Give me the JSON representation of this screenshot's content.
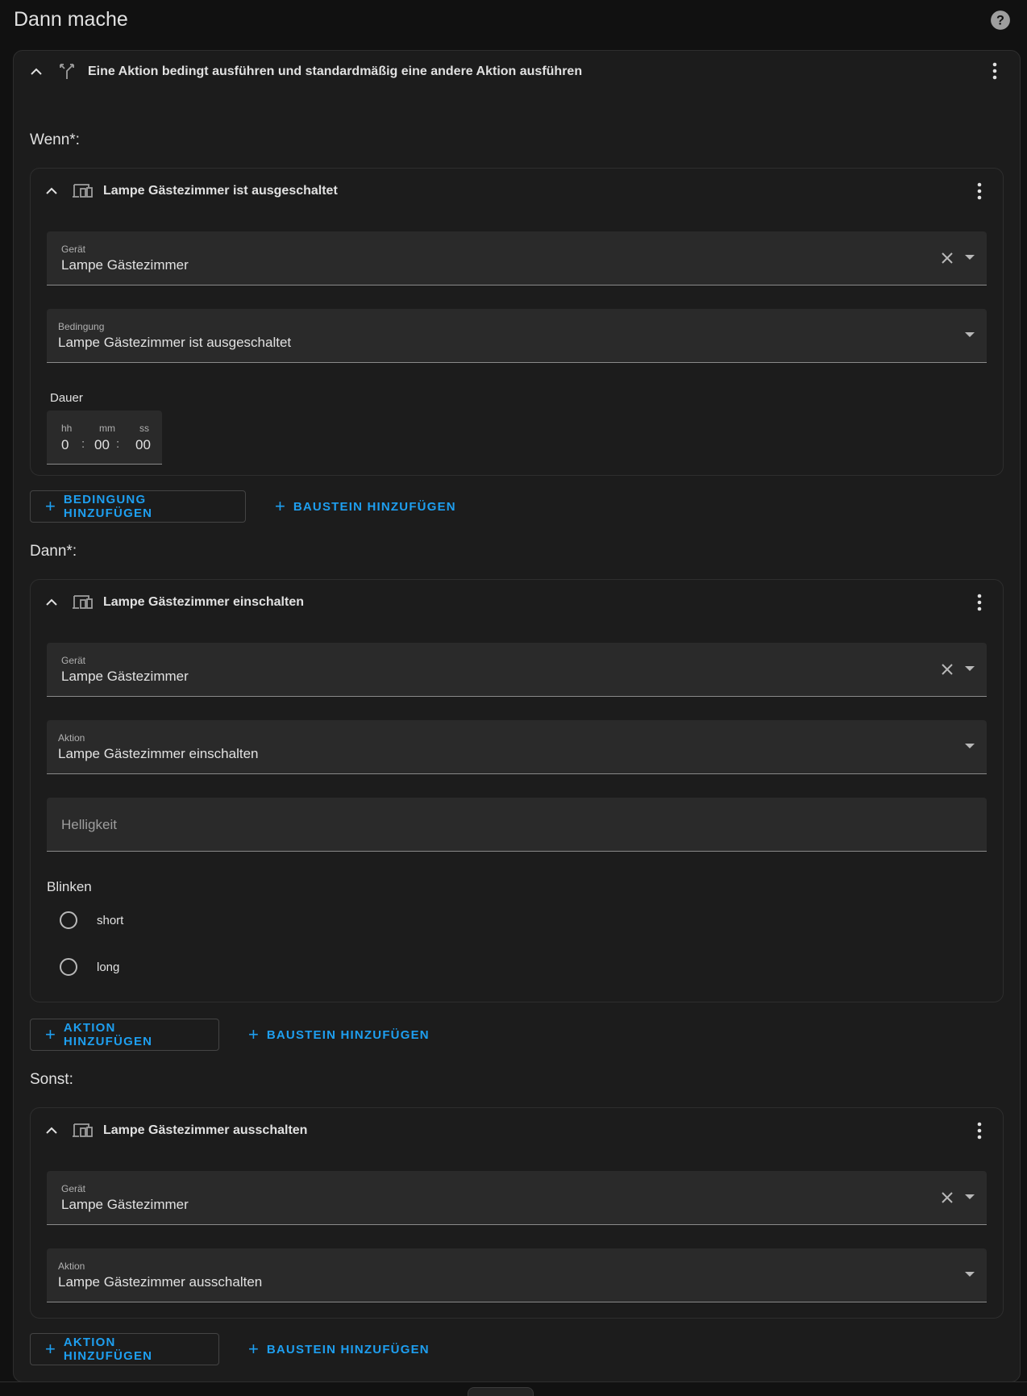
{
  "page": {
    "title": "Dann mache"
  },
  "outer": {
    "header": "Eine Aktion bedingt ausführen und standardmäßig eine andere Aktion ausführen"
  },
  "if": {
    "label": "Wenn*:",
    "card_title": "Lampe Gästezimmer ist ausgeschaltet",
    "device_label": "Gerät",
    "device_value": "Lampe Gästezimmer",
    "condition_label": "Bedingung",
    "condition_value": "Lampe Gästezimmer ist ausgeschaltet",
    "duration_label": "Dauer",
    "duration": {
      "hh_label": "hh",
      "mm_label": "mm",
      "ss_label": "ss",
      "hh": "0",
      "mm": "00",
      "ss": "00",
      "sep": ":"
    },
    "add_condition": "BEDINGUNG HINZUFÜGEN",
    "add_block": "BAUSTEIN HINZUFÜGEN"
  },
  "then": {
    "label": "Dann*:",
    "card_title": "Lampe Gästezimmer einschalten",
    "device_label": "Gerät",
    "device_value": "Lampe Gästezimmer",
    "action_label": "Aktion",
    "action_value": "Lampe Gästezimmer einschalten",
    "brightness_placeholder": "Helligkeit",
    "flash_label": "Blinken",
    "flash_options": [
      "short",
      "long"
    ],
    "add_action": "AKTION HINZUFÜGEN",
    "add_block": "BAUSTEIN HINZUFÜGEN"
  },
  "else": {
    "label": "Sonst:",
    "card_title": "Lampe Gästezimmer ausschalten",
    "device_label": "Gerät",
    "device_value": "Lampe Gästezimmer",
    "action_label": "Aktion",
    "action_value": "Lampe Gästezimmer ausschalten",
    "add_action": "AKTION HINZUFÜGEN",
    "add_block": "BAUSTEIN HINZUFÜGEN"
  },
  "icons": {
    "help": "help-circle-icon",
    "collapse": "chevron-up-icon",
    "branch": "call-split-icon",
    "device": "devices-icon",
    "menu": "dots-vertical-icon",
    "clear": "close-icon",
    "dropdown": "menu-down-icon",
    "add": "plus-icon"
  },
  "colors": {
    "background": "#111111",
    "card": "#1c1c1c",
    "field": "#2a2a2a",
    "accent": "#1e9ff0",
    "text": "#e1e1e1"
  }
}
